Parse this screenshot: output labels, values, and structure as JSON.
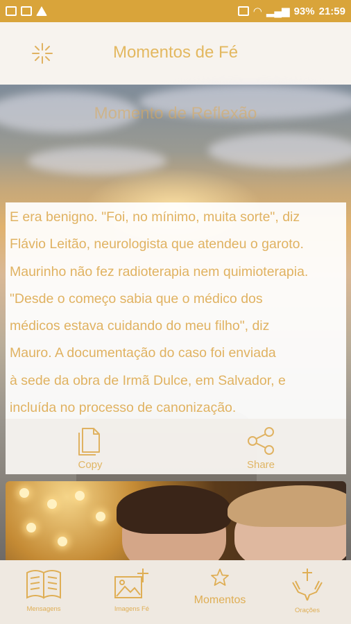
{
  "status_bar": {
    "battery": "93%",
    "time": "21:59"
  },
  "app": {
    "title": "Momentos de Fé"
  },
  "hero": {
    "heading": "Momento de Reflexão"
  },
  "message": {
    "lines": [
      "E era benigno. \"Foi, no mínimo, muita sorte\", diz",
      "Flávio Leitão, neurologista que atendeu o garoto.",
      "Maurinho não fez radioterapia nem quimioterapia.",
      "\"Desde o começo sabia que o médico dos",
      "médicos estava cuidando do meu filho\", diz",
      "Mauro. A documentação do caso foi enviada",
      "à sede da obra de Irmã Dulce, em Salvador, e",
      "incluída no processo de canonização."
    ]
  },
  "actions": {
    "copy_label": "Copy",
    "share_label": "Share"
  },
  "nav": {
    "items": [
      {
        "label": "Mensagens",
        "icon": "book-icon"
      },
      {
        "label": "Imagens Fé",
        "icon": "image-cross-icon"
      },
      {
        "label": "Momentos",
        "icon": "star-icon"
      },
      {
        "label": "Orações",
        "icon": "praying-hands-icon"
      }
    ]
  },
  "colors": {
    "accent": "#e0b261",
    "status_bar": "#d9a43a"
  }
}
